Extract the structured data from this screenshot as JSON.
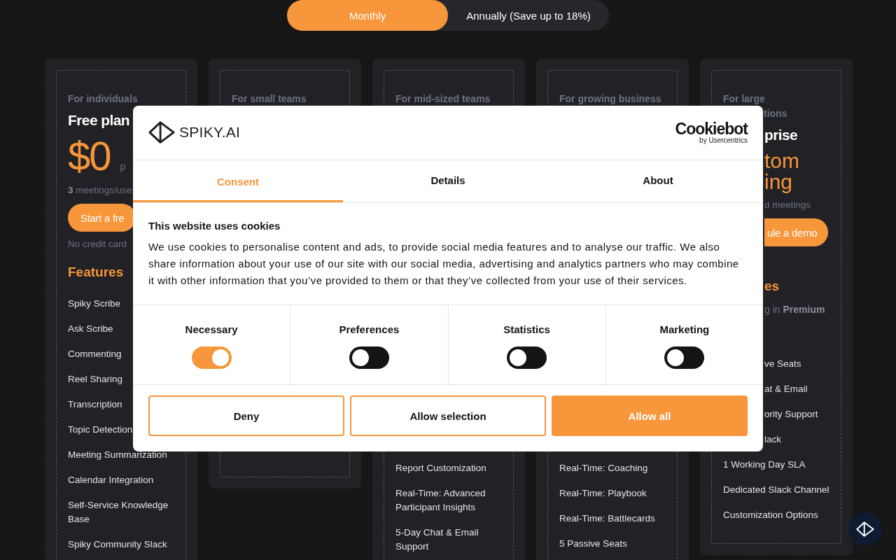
{
  "billing_toggle": [
    {
      "label": "Monthly",
      "selected": true
    },
    {
      "label": "Annually (Save up to 18%)",
      "selected": false
    }
  ],
  "plans": [
    {
      "kind": "full",
      "label": "For individuals",
      "name": "Free plan",
      "price": "$0",
      "price_note": "p",
      "meetings": "**3** meetings/use",
      "cta": "Start a fre",
      "cta_note": "No credit card",
      "features_title": "Features",
      "features": [
        {
          "text": "Spiky Scribe",
          "clipped": false
        },
        {
          "text": "Ask Scribe",
          "clipped": false
        },
        {
          "text": "Commenting",
          "clipped": false
        },
        {
          "text": "Reel Sharing",
          "clipped": false
        },
        {
          "text": "Transcription",
          "clipped": false
        },
        {
          "text": "Topic Detection",
          "clipped": false
        },
        {
          "text": "Meeting Summarization",
          "clipped": false
        },
        {
          "text": "Calendar Integration",
          "clipped": false
        },
        {
          "text": "Self-Service Knowledge Base",
          "clipped": false
        },
        {
          "text": "Spiky Community Slack",
          "clipped": false
        }
      ]
    },
    {
      "kind": "covered",
      "label": "For small teams"
    },
    {
      "kind": "covered",
      "label": "For mid-sized teams",
      "features": [
        {
          "text": "Report Customization",
          "clipped": false
        },
        {
          "text": "Real-Time: Advanced Participant Insights",
          "clipped": false
        },
        {
          "text": "5-Day Chat & Email Support",
          "clipped": false
        }
      ]
    },
    {
      "kind": "covered",
      "label": "For growing business",
      "features": [
        {
          "text": "Real-Time: Coaching",
          "clipped": false
        },
        {
          "text": "Real-Time: Playbook",
          "clipped": false
        },
        {
          "text": "Real-Time: Battlecards",
          "clipped": false
        },
        {
          "text": "5 Passive Seats",
          "clipped": false
        }
      ]
    },
    {
      "kind": "partial",
      "label": "For large",
      "label_tail": "tions",
      "name": "prise",
      "price": "tom",
      "price_tail": "ing",
      "meetings": "d meetings",
      "cta": "ule a demo",
      "features_title": "es",
      "includes": "g in **Premium**",
      "features": [
        {
          "text": "ve Seats",
          "clipped": true
        },
        {
          "text": "at & Email",
          "clipped": true
        },
        {
          "text": "ority Support",
          "clipped": true
        },
        {
          "text": "lack",
          "clipped": true
        },
        {
          "text": "1 Working Day SLA",
          "clipped": false
        },
        {
          "text": "Dedicated Slack Channel",
          "clipped": false
        },
        {
          "text": "Customization Options",
          "clipped": false
        }
      ]
    }
  ],
  "cookie_dialog": {
    "logo_text": "SPIKY.AI",
    "brand": {
      "name": "Cookiebot",
      "tagline": "by Usercentrics"
    },
    "tabs": [
      {
        "label": "Consent",
        "selected": true
      },
      {
        "label": "Details",
        "selected": false
      },
      {
        "label": "About",
        "selected": false
      }
    ],
    "title": "This website uses cookies",
    "body": "We use cookies to personalise content and ads, to provide social media features and to analyse our traffic. We also share information about your use of our site with our social media, advertising and analytics partners who may combine it with other information that you’ve provided to them or that they’ve collected from your use of their services.",
    "categories": [
      {
        "label": "Necessary",
        "checked": true
      },
      {
        "label": "Preferences",
        "checked": false
      },
      {
        "label": "Statistics",
        "checked": false
      },
      {
        "label": "Marketing",
        "checked": false
      }
    ],
    "buttons": [
      {
        "label": "Deny",
        "kind": "outline"
      },
      {
        "label": "Allow selection",
        "kind": "outline"
      },
      {
        "label": "Allow all",
        "kind": "filled"
      }
    ]
  }
}
